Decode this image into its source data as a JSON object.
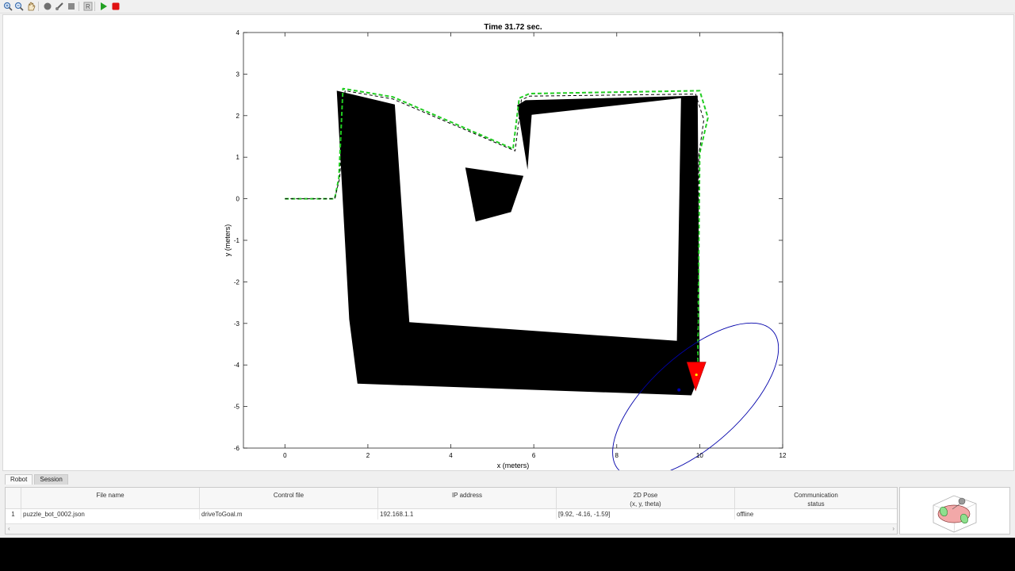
{
  "toolbar": {
    "buttons": [
      {
        "name": "zoom-in-icon",
        "glyph": "🔍︎"
      },
      {
        "name": "zoom-out-icon",
        "glyph": "🔍︎"
      },
      {
        "name": "pan-hand-icon",
        "glyph": "✋︎"
      },
      {
        "name": "record-icon",
        "glyph": "●"
      },
      {
        "name": "data-cursor-icon",
        "glyph": "✎"
      },
      {
        "name": "stop-square-icon",
        "glyph": "■"
      },
      {
        "name": "reset-icon",
        "glyph": "R"
      },
      {
        "name": "run-play-icon",
        "glyph": "▶"
      },
      {
        "name": "stop-red-icon",
        "glyph": "■"
      }
    ]
  },
  "plot": {
    "title": "Time 31.72 sec.",
    "xlabel": "x (meters)",
    "ylabel": "y (meters)",
    "xlim": [
      -1,
      12
    ],
    "ylim": [
      -6,
      4
    ],
    "xticks": [
      "0",
      "2",
      "4",
      "6",
      "8",
      "10",
      "12"
    ],
    "yticks": [
      "4",
      "3",
      "2",
      "1",
      "0",
      "-1",
      "-2",
      "-3",
      "-4",
      "-5",
      "-6"
    ]
  },
  "chart_data": {
    "type": "line",
    "title": "Time 31.72 sec.",
    "xlabel": "x (meters)",
    "ylabel": "y (meters)",
    "xlim": [
      -1,
      12
    ],
    "ylim": [
      -6,
      4
    ],
    "grid": false,
    "obstacles": [
      [
        [
          1.25,
          2.6
        ],
        [
          2.65,
          2.27
        ],
        [
          3.0,
          -2.97
        ],
        [
          9.45,
          -3.42
        ],
        [
          9.55,
          2.42
        ],
        [
          5.95,
          2.02
        ],
        [
          5.85,
          0.7
        ],
        [
          5.6,
          2.25
        ],
        [
          5.8,
          2.37
        ],
        [
          9.95,
          2.48
        ],
        [
          10.0,
          -4.22
        ],
        [
          9.8,
          -4.73
        ],
        [
          1.75,
          -4.45
        ],
        [
          1.55,
          -2.9
        ],
        [
          1.25,
          2.6
        ]
      ],
      [
        [
          4.35,
          0.75
        ],
        [
          5.75,
          0.55
        ],
        [
          5.45,
          -0.32
        ],
        [
          4.6,
          -0.55
        ],
        [
          4.35,
          0.75
        ]
      ]
    ],
    "series": [
      {
        "style": "dashed-green",
        "color": "#22cc22",
        "x": [
          0.0,
          1.2,
          1.3,
          1.4,
          2.6,
          5.5,
          5.65,
          5.9,
          10.0,
          10.2,
          10.0,
          9.95
        ],
        "y": [
          0.0,
          0.0,
          0.5,
          2.65,
          2.45,
          1.2,
          2.42,
          2.53,
          2.6,
          1.95,
          1.1,
          -4.2
        ]
      },
      {
        "style": "dashed-black",
        "color": "#000000",
        "x": [
          0.0,
          1.2,
          1.32,
          1.45,
          2.6,
          5.55,
          5.7,
          5.9,
          9.9,
          10.1,
          9.98,
          9.93
        ],
        "y": [
          0.0,
          0.0,
          0.5,
          2.6,
          2.4,
          1.15,
          2.38,
          2.47,
          2.52,
          1.9,
          1.05,
          -4.2
        ]
      }
    ],
    "robot": {
      "x": 9.92,
      "y": -4.16,
      "theta": -1.59,
      "color": "#ff0000"
    },
    "covariance_ellipse": {
      "cx": 9.9,
      "cy": -4.85,
      "rx": 2.5,
      "ry": 1.1,
      "angle_deg": -42,
      "color": "#0000aa"
    },
    "estimate_point": {
      "x": 9.5,
      "y": -4.6,
      "color": "#0000aa"
    }
  },
  "tabs": [
    {
      "label": "Robot",
      "active": true
    },
    {
      "label": "Session",
      "active": false
    }
  ],
  "table": {
    "headers": [
      {
        "line1": "File name",
        "line2": ""
      },
      {
        "line1": "Control file",
        "line2": ""
      },
      {
        "line1": "IP address",
        "line2": ""
      },
      {
        "line1": "2D Pose",
        "line2": "(x, y, theta)"
      },
      {
        "line1": "Communication",
        "line2": "status"
      }
    ],
    "rows": [
      {
        "index": "1",
        "file_name": "puzzle_bot_0002.json",
        "control_file": "driveToGoal.m",
        "ip": "192.168.1.1",
        "pose": "[9.92, -4.16, -1.59]",
        "status": "offline"
      }
    ],
    "scroll_left": "‹",
    "scroll_right": "›"
  },
  "preview": {
    "icon": "robot-model-icon"
  }
}
